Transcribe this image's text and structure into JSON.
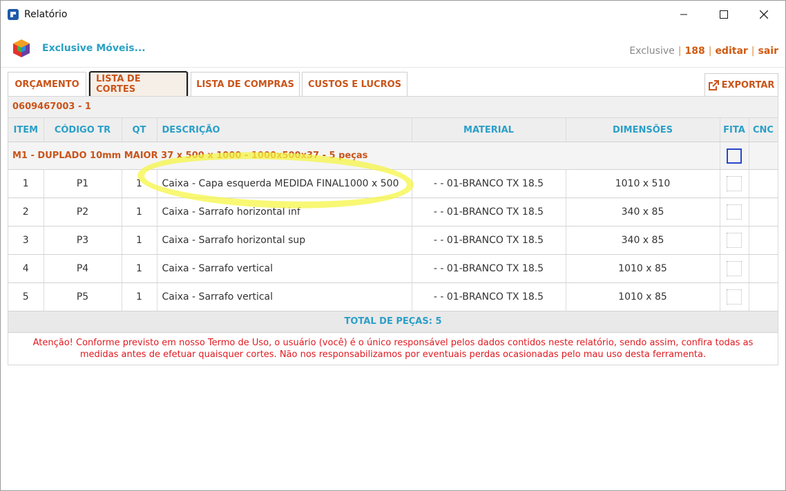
{
  "window": {
    "title": "Relatório"
  },
  "header": {
    "company": "Exclusive Móveis...",
    "user": "Exclusive",
    "separator": "|",
    "count": "188",
    "edit_label": "editar",
    "exit_label": "sair"
  },
  "tabs": [
    {
      "label": "ORÇAMENTO",
      "active": false
    },
    {
      "label": "LISTA DE CORTES",
      "active": true
    },
    {
      "label": "LISTA DE COMPRAS",
      "active": false
    },
    {
      "label": "CUSTOS E LUCROS",
      "active": false
    }
  ],
  "export_label": "EXPORTAR",
  "project_code": "0609467003 - 1",
  "columns": {
    "item": "ITEM",
    "code": "CÓDIGO TR",
    "qt": "QT",
    "desc": "DESCRIÇÃO",
    "material": "MATERIAL",
    "dims": "DIMENSÕES",
    "fita": "FITA",
    "cnc": "CNC"
  },
  "group": {
    "label_main": "M1 - DUPLADO 10mm MAIOR ",
    "label_rest": "37 x 500 x 1000 - 1000x500x37 - 5 peças"
  },
  "rows": [
    {
      "item": "1",
      "code": "P1",
      "qt": "1",
      "desc": "Caixa - Capa esquerda MEDIDA FINAL1000 x 500",
      "material": "- - 01-BRANCO TX 18.5",
      "dims": "1010 x 510"
    },
    {
      "item": "2",
      "code": "P2",
      "qt": "1",
      "desc": "Caixa - Sarrafo horizontal inf",
      "material": "- - 01-BRANCO TX 18.5",
      "dims": "340 x 85"
    },
    {
      "item": "3",
      "code": "P3",
      "qt": "1",
      "desc": "Caixa - Sarrafo horizontal sup",
      "material": "- - 01-BRANCO TX 18.5",
      "dims": "340 x 85"
    },
    {
      "item": "4",
      "code": "P4",
      "qt": "1",
      "desc": "Caixa - Sarrafo vertical",
      "material": "- - 01-BRANCO TX 18.5",
      "dims": "1010 x 85"
    },
    {
      "item": "5",
      "code": "P5",
      "qt": "1",
      "desc": "Caixa - Sarrafo vertical",
      "material": "- - 01-BRANCO TX 18.5",
      "dims": "1010 x 85"
    }
  ],
  "total_label": "TOTAL DE PEÇAS: 5",
  "warning": "Atenção! Conforme previsto em nosso Termo de Uso, o usuário (você) é o único responsável pelos dados contidos neste relatório, sendo assim, confira todas as medidas antes de efetuar quaisquer cortes. Não nos responsabilizamos por eventuais perdas ocasionadas pelo mau uso desta ferramenta.",
  "colors": {
    "accent_orange": "#c9541a",
    "accent_blue": "#2b9fc8",
    "warning_red": "#e0191f",
    "highlight": "#f5f546"
  },
  "icons": {
    "app": "sketchup-icon",
    "logo": "cube-logo-icon",
    "export": "external-link-icon"
  }
}
